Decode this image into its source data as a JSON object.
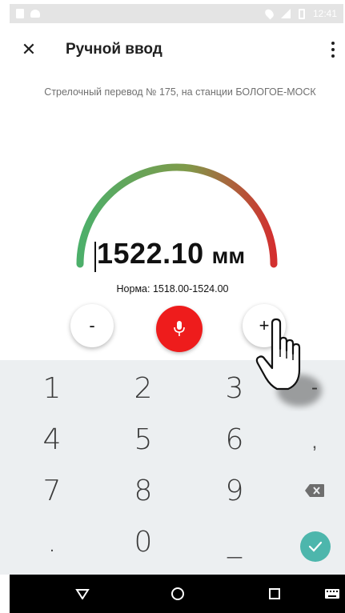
{
  "status_bar": {
    "time": "12:41"
  },
  "app_bar": {
    "title": "Ручной ввод"
  },
  "subtitle": "Стрелочный перевод № 175, на станции БОЛОГОЕ-МОСК",
  "reading": {
    "value": "1522.10",
    "unit": "мм",
    "norm": "Норма: 1518.00-1524.00"
  },
  "controls": {
    "minus": "-",
    "plus": "+"
  },
  "keypad": {
    "rows": [
      [
        "1",
        "2",
        "3"
      ],
      [
        "4",
        "5",
        "6"
      ],
      [
        "7",
        "8",
        "9"
      ],
      [
        ".",
        "0",
        "_"
      ]
    ],
    "side": {
      "minus": "-",
      "comma": ","
    }
  },
  "colors": {
    "gauge_start": "#4caf6a",
    "gauge_end": "#d32f2f",
    "mic": "#ee1c1c",
    "done": "#4db6ac"
  },
  "icons": [
    "close-icon",
    "more-vert-icon",
    "mic-icon",
    "backspace-icon",
    "check-icon",
    "back-icon",
    "home-icon",
    "recents-icon",
    "keyboard-icon"
  ]
}
